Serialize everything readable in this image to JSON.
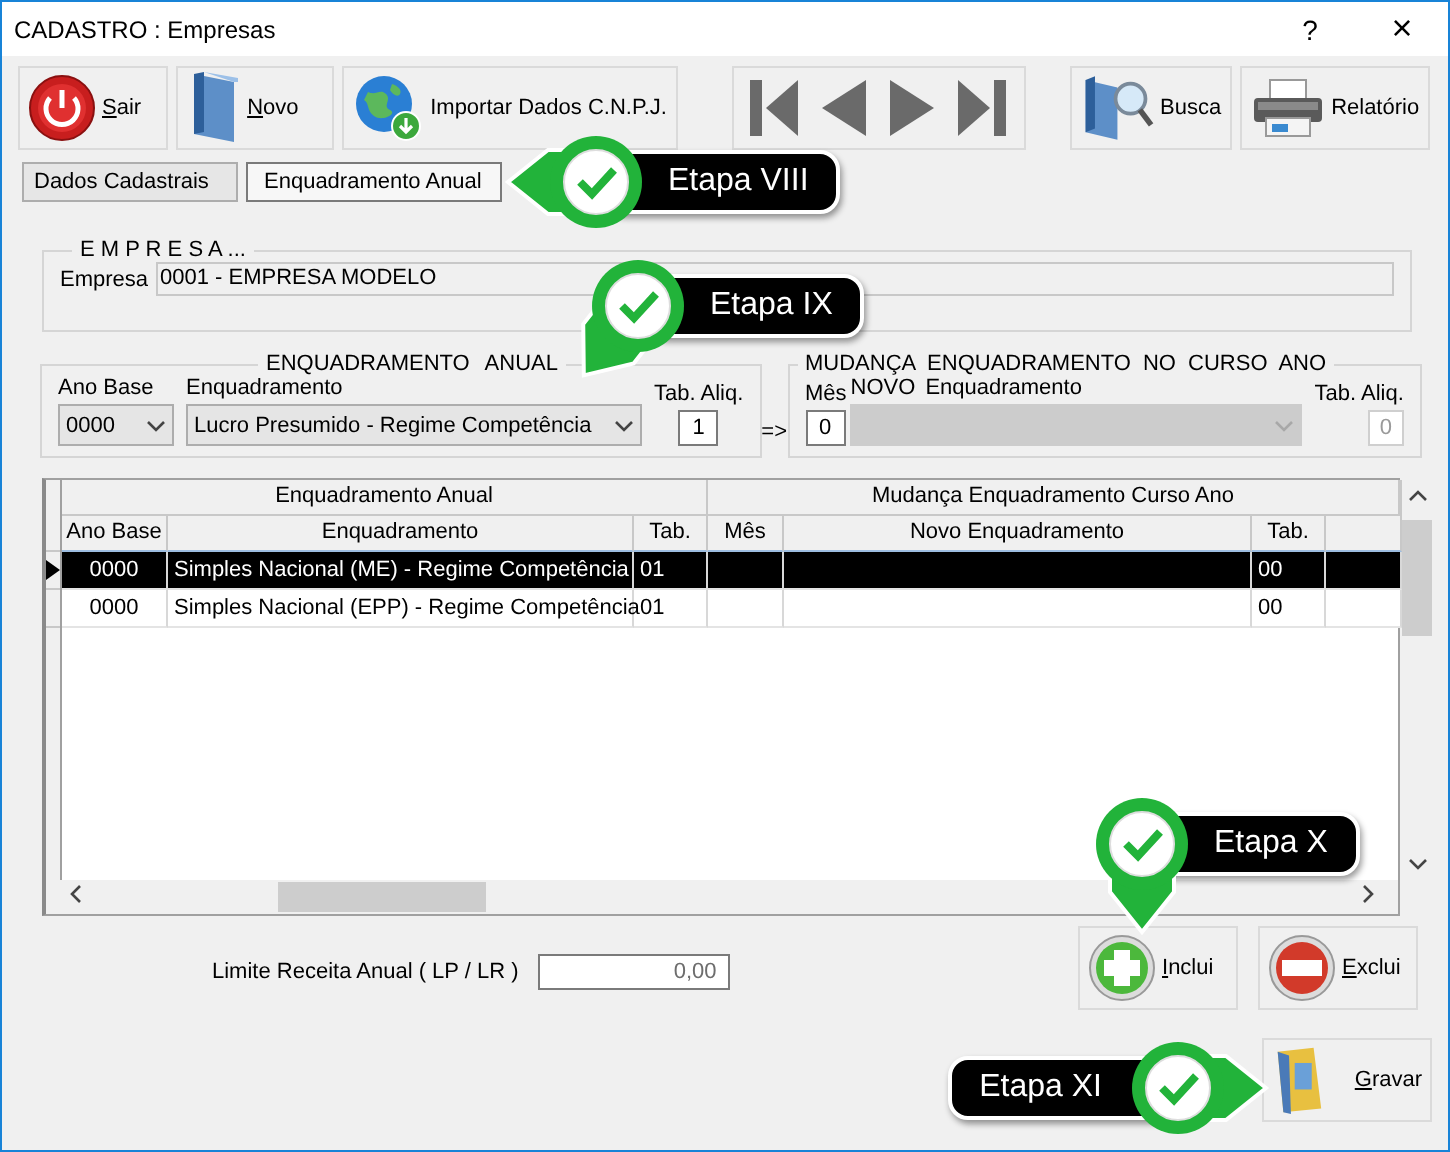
{
  "window": {
    "title": "CADASTRO : Empresas",
    "help": "?",
    "close": "×"
  },
  "toolbar": {
    "left": [
      {
        "label": "Sair"
      },
      {
        "label": "Novo"
      },
      {
        "label": "Importar Dados C.N.P.J."
      }
    ],
    "navigation": [
      {
        "kind": "first"
      },
      {
        "kind": "prev"
      },
      {
        "kind": "next"
      },
      {
        "kind": "last"
      }
    ],
    "right": [
      {
        "label": "Busca"
      },
      {
        "label": "Relatório"
      }
    ]
  },
  "tabs": [
    {
      "label": "Dados Cadastrais",
      "selected": false
    },
    {
      "label": "Enquadramento Anual",
      "selected": true
    }
  ],
  "empresa": {
    "legend": "E M P R E S A ...",
    "label": "Empresa",
    "value": "0001 - EMPRESA MODELO"
  },
  "enquadramento_anual": {
    "legend": "ENQUADRAMENTO ANUAL",
    "ano_base_label": "Ano Base",
    "ano_base_value": "0000",
    "enquadramento_label": "Enquadramento",
    "enquadramento_value": "Lucro Presumido - Regime Competência",
    "tab_label": "Tab. Aliq.",
    "tab_value": "1"
  },
  "arrow": "=>",
  "mudanca": {
    "legend": "MUDANÇA ENQUADRAMENTO NO CURSO ANO",
    "mes_label": "Mês",
    "mes_value": "0",
    "novo_label": "NOVO",
    "enquadramento_label": "Enquadramento",
    "enquadramento_disabled": true,
    "tab_label": "Tab. Aliq.",
    "tab_value": "0",
    "tab_disabled": true
  },
  "grid": {
    "groups": [
      {
        "label": "Enquadramento Anual",
        "columns": [
          "Ano Base",
          "Enquadramento",
          "Tab."
        ]
      },
      {
        "label": "Mudança Enquadramento Curso Ano",
        "columns": [
          "Mês",
          "Novo Enquadramento",
          "Tab."
        ]
      }
    ],
    "rows": [
      {
        "selected": true,
        "ano_base": "0000",
        "enquadramento": "Simples Nacional (ME) - Regime Competência",
        "tab": "01",
        "tab_novo": "00"
      },
      {
        "selected": false,
        "ano_base": "0000",
        "enquadramento": "Simples Nacional (EPP) - Regime Competência",
        "tab": "01",
        "tab_novo": "00"
      }
    ]
  },
  "limite": {
    "label": "Limite Receita Anual ( LP / LR )",
    "value": "0,00"
  },
  "actions": [
    {
      "label": "Inclui"
    },
    {
      "label": "Exclui"
    }
  ],
  "save": {
    "label": "Gravar"
  },
  "callouts": [
    {
      "label": "Etapa VIII"
    },
    {
      "label": "Etapa IX"
    },
    {
      "label": "Etapa X"
    },
    {
      "label": "Etapa XI"
    }
  ]
}
